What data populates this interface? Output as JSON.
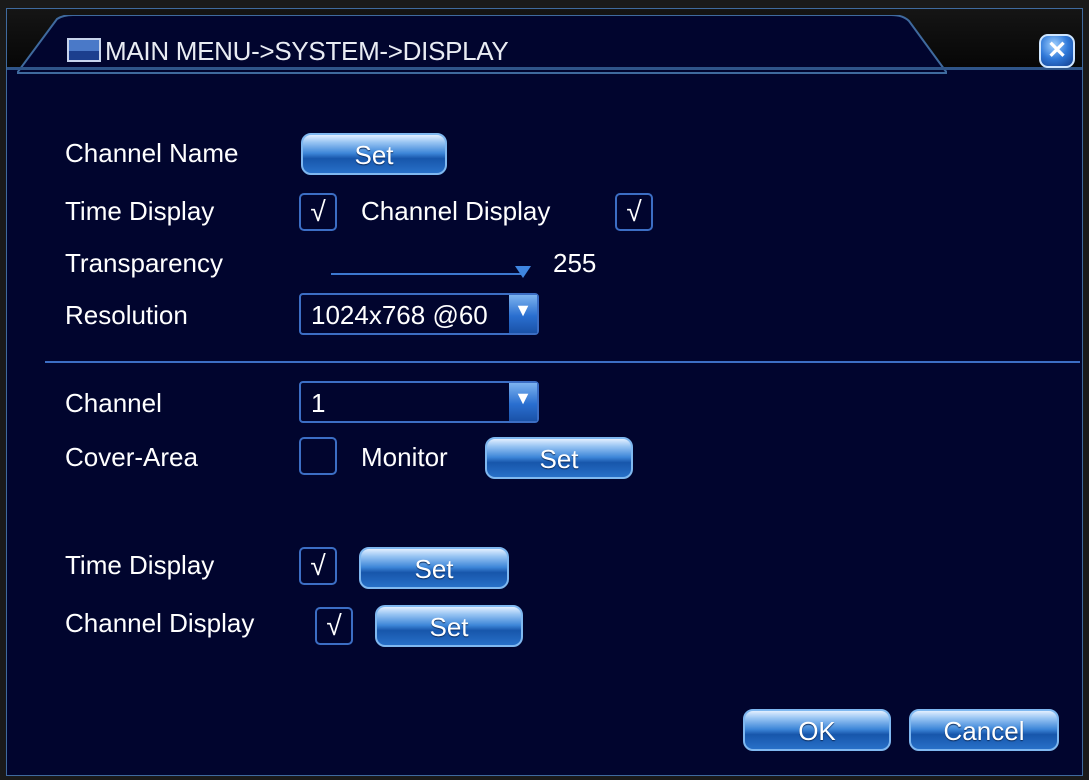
{
  "window": {
    "title": "MAIN MENU->SYSTEM->DISPLAY",
    "close_icon": "close-icon",
    "close_label": "✕"
  },
  "fields": {
    "channel_name_label": "Channel Name",
    "channel_name_button": "Set",
    "time_display_label": "Time Display",
    "time_display_checked": "√",
    "channel_display_label": "Channel Display",
    "channel_display_checked": "√",
    "transparency_label": "Transparency",
    "transparency_value": "255",
    "transparency_level": 1.0,
    "resolution_label": "Resolution",
    "resolution_value": "1024x768 @60",
    "resolution_arrow": "▼"
  },
  "channel_section": {
    "channel_label": "Channel",
    "channel_value": "1",
    "channel_arrow": "▼",
    "cover_area_label": "Cover-Area",
    "cover_area_checked": "",
    "monitor_label": "Monitor",
    "monitor_button": "Set",
    "time_display_label": "Time Display",
    "time_display_checked": "√",
    "time_display_button": "Set",
    "channel_display_label": "Channel Display",
    "channel_display_checked": "√",
    "channel_display_button": "Set"
  },
  "footer": {
    "ok_label": "OK",
    "cancel_label": "Cancel"
  },
  "colors": {
    "background": "#01052e",
    "accent": "#3c6ec4",
    "button": "#2870c8"
  }
}
